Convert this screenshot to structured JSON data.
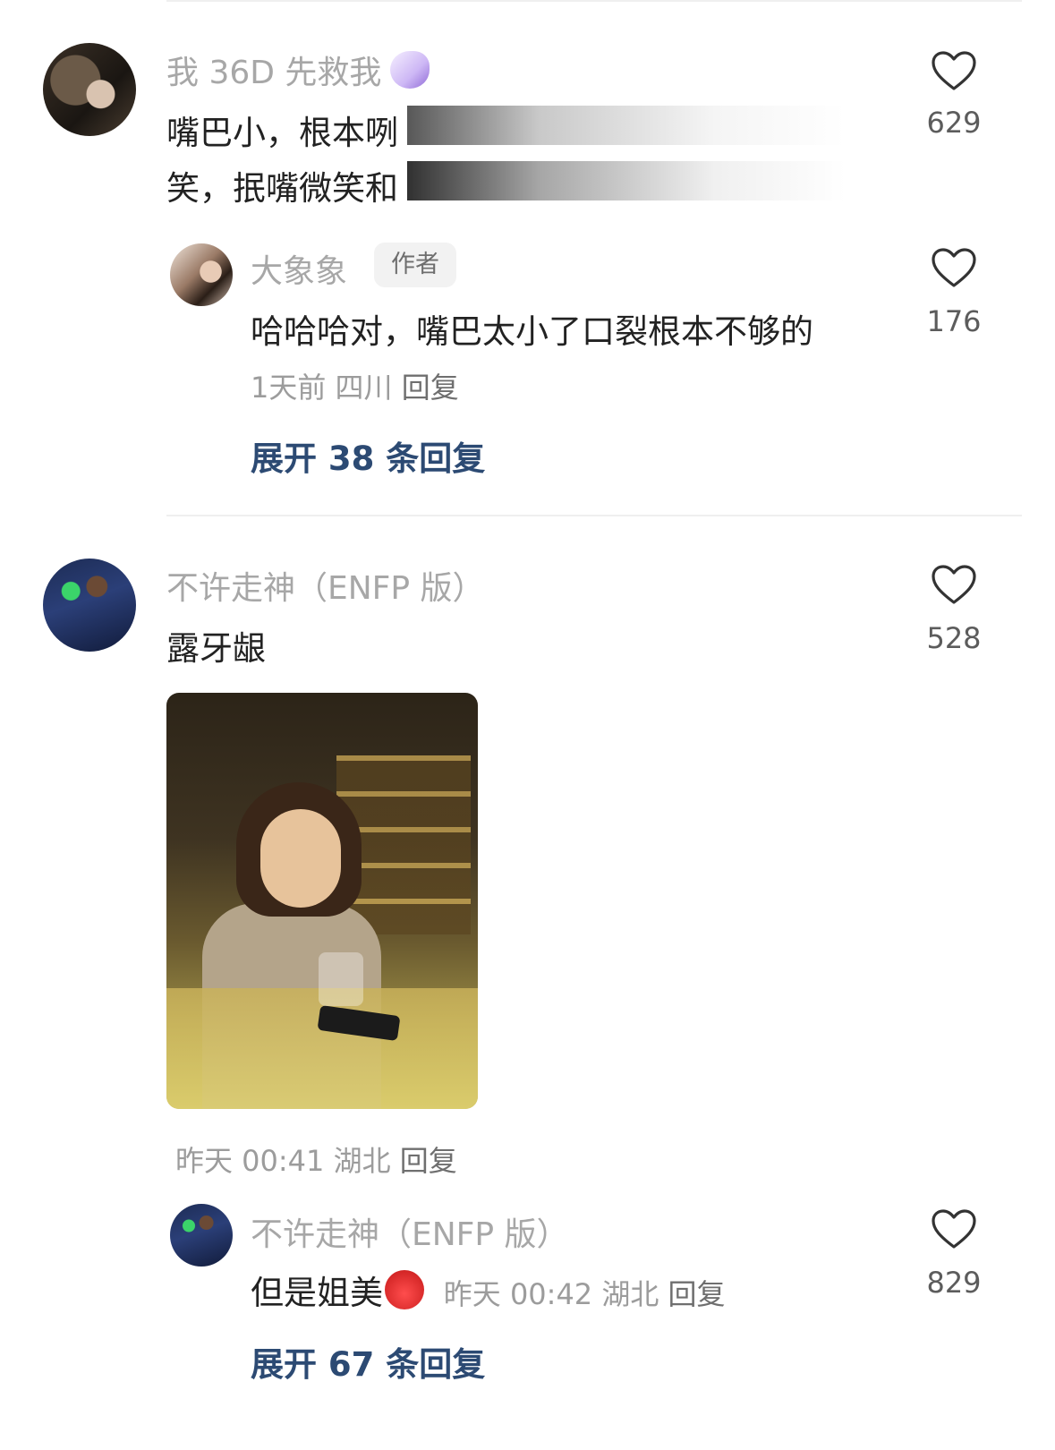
{
  "comments": [
    {
      "username": "我 36D 先救我",
      "line1": "嘴巴小，根本咧",
      "line2": "笑，抿嘴微笑和",
      "likes": "629",
      "reply": {
        "username": "大象象",
        "author_badge": "作者",
        "text": "哈哈哈对，嘴巴太小了口裂根本不够的",
        "likes": "176",
        "meta_time": "1天前",
        "meta_location": "四川",
        "meta_reply": "回复"
      },
      "expand_label": "展开 38 条回复"
    },
    {
      "username": "不许走神（ENFP 版）",
      "text": "露牙龈",
      "likes": "528",
      "meta_time": "昨天 00:41",
      "meta_location": "湖北",
      "meta_reply": "回复",
      "reply": {
        "username": "不许走神（ENFP 版）",
        "text": "但是姐美",
        "meta_time": "昨天 00:42",
        "meta_location": "湖北",
        "meta_reply": "回复",
        "likes": "829"
      },
      "expand_label": "展开 67 条回复"
    }
  ],
  "icons": {
    "like": "heart-outline-icon",
    "emoji_1": "unicorn-emoji",
    "emoji_2": "devil-emoji"
  },
  "colors": {
    "username": "#a7a7a7",
    "expand": "#2c4a73",
    "meta": "#9c9c9c"
  }
}
